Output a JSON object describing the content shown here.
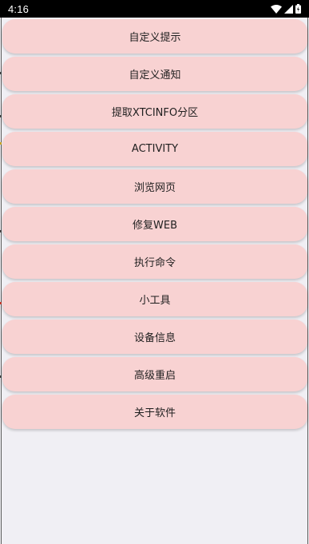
{
  "status_bar": {
    "time": "4:16",
    "icons": [
      "wifi-icon",
      "signal-icon",
      "battery-icon"
    ]
  },
  "menu": {
    "items": [
      {
        "label": "自定义提示"
      },
      {
        "label": "自定义通知"
      },
      {
        "label": "提取XTCINFO分区"
      },
      {
        "label": "ACTIVITY"
      },
      {
        "label": "浏览网页"
      },
      {
        "label": "修复WEB"
      },
      {
        "label": "执行命令"
      },
      {
        "label": "小工具"
      },
      {
        "label": "设备信息"
      },
      {
        "label": "高级重启"
      },
      {
        "label": "关于软件"
      }
    ]
  },
  "colors": {
    "button_bg": "#f8d2d2",
    "page_bg": "#f0eff4",
    "status_bar_bg": "#000000"
  }
}
